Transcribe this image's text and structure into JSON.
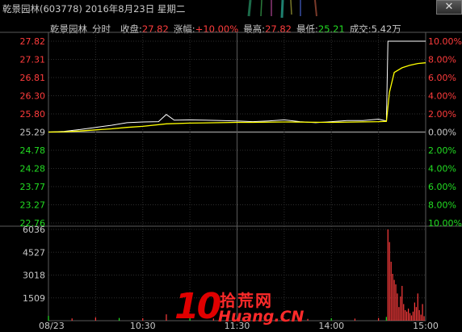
{
  "window": {
    "title": "乾景园林(603778) 2016年8月23日 星期二",
    "close_glyph": "✕"
  },
  "header": {
    "stock_name": "乾景园林",
    "mode": "分时",
    "close_label": "收盘:",
    "close_value": "27.82",
    "change_label": "涨幅:",
    "change_value": "+10.00%",
    "high_label": "最高:",
    "high_value": "27.82",
    "low_label": "最低:",
    "low_value": "25.21",
    "volume_label": "成交:",
    "volume_value": "5.42万"
  },
  "price_axis": {
    "left": [
      "27.82",
      "27.31",
      "26.81",
      "26.30",
      "25.80",
      "25.29",
      "24.78",
      "24.28",
      "23.77",
      "23.27",
      "22.76"
    ],
    "right": [
      "10.00%",
      "8.00%",
      "6.00%",
      "4.00%",
      "2.00%",
      "0.00%",
      "2.00%",
      "4.00%",
      "6.00%",
      "8.00%",
      "10.00%"
    ]
  },
  "volume_axis": {
    "labels": [
      "6036",
      "4527",
      "3018",
      "1509"
    ]
  },
  "time_axis": {
    "labels": [
      "08/23",
      "10:30",
      "11:30",
      "14:00",
      "15:00"
    ]
  },
  "watermark": {
    "digits": "10",
    "cn": "拾荒网",
    "en": "Huang.CN"
  },
  "colors": {
    "up": "#ff3c3c",
    "down": "#22dd22",
    "neutral": "#c8c8c8",
    "price_line": "#ffffff",
    "avg_line": "#ffff00",
    "grid": "#333333"
  },
  "chart_data": {
    "type": "line",
    "prev_close": 25.29,
    "ylim": [
      22.76,
      27.82
    ],
    "series": [
      {
        "x": [
          "09:30",
          "09:40",
          "09:50",
          "10:00",
          "10:10",
          "10:20",
          "10:30",
          "10:40",
          "10:45",
          "10:50",
          "11:00",
          "11:10",
          "11:20",
          "11:30",
          "13:10",
          "13:20",
          "13:30",
          "13:40",
          "13:50",
          "14:00",
          "14:10",
          "14:20",
          "14:30",
          "14:35",
          "14:36",
          "14:40",
          "14:45",
          "14:50",
          "15:00"
        ],
        "values": [
          25.29,
          25.31,
          25.36,
          25.42,
          25.48,
          25.55,
          25.57,
          25.58,
          25.78,
          25.62,
          25.63,
          25.62,
          25.61,
          25.6,
          25.58,
          25.6,
          25.63,
          25.58,
          25.55,
          25.58,
          25.61,
          25.61,
          25.65,
          25.6,
          27.82,
          27.82,
          27.82,
          27.82,
          27.82
        ]
      },
      {
        "x": [
          "09:30",
          "09:40",
          "09:50",
          "10:00",
          "10:10",
          "10:20",
          "10:30",
          "10:45",
          "11:00",
          "11:30",
          "13:10",
          "13:30",
          "14:00",
          "14:30",
          "14:35",
          "14:37",
          "14:40",
          "14:45",
          "14:50",
          "14:55",
          "15:00"
        ],
        "values": [
          25.29,
          25.3,
          25.32,
          25.35,
          25.38,
          25.42,
          25.45,
          25.52,
          25.54,
          25.56,
          25.56,
          25.57,
          25.56,
          25.58,
          25.59,
          26.4,
          26.95,
          27.08,
          27.15,
          27.2,
          27.22
        ]
      }
    ],
    "volume": {
      "ylim": [
        0,
        6036
      ],
      "x": [
        "09:30",
        "09:45",
        "10:00",
        "10:15",
        "10:30",
        "10:45",
        "11:00",
        "11:15",
        "11:30",
        "13:15",
        "13:30",
        "13:45",
        "14:00",
        "14:15",
        "14:30",
        "14:35",
        "14:36",
        "14:37",
        "14:38",
        "14:39",
        "14:40",
        "14:41",
        "14:42",
        "14:43",
        "14:44",
        "14:45",
        "14:46",
        "14:47",
        "14:48",
        "14:49",
        "14:50",
        "14:51",
        "14:52",
        "14:53",
        "14:54",
        "14:55",
        "14:56",
        "14:57",
        "14:58",
        "14:59"
      ],
      "values": [
        320,
        150,
        220,
        180,
        160,
        420,
        280,
        150,
        140,
        200,
        130,
        120,
        160,
        140,
        180,
        250,
        6036,
        5200,
        3900,
        3100,
        2700,
        2400,
        1800,
        900,
        1600,
        2300,
        1100,
        700,
        600,
        800,
        500,
        350,
        600,
        1200,
        900,
        1800,
        700,
        400,
        1100,
        300
      ]
    },
    "xlabels": [
      "08/23",
      "10:30",
      "11:30",
      "14:00",
      "15:00"
    ]
  }
}
